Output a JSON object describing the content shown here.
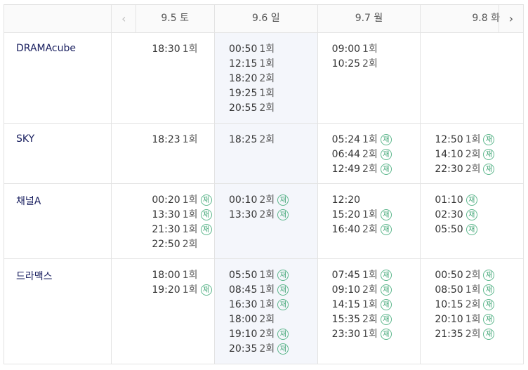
{
  "nav": {
    "prev_icon": "‹",
    "next_icon": "›"
  },
  "days": [
    "9.5 토",
    "9.6 일",
    "9.7 월",
    "9.8 화"
  ],
  "rerun_badge": "재",
  "channels": [
    {
      "name": "DRAMAcube",
      "slots": [
        [
          {
            "time": "18:30",
            "ep": "1회",
            "re": false
          }
        ],
        [
          {
            "time": "00:50",
            "ep": "1회",
            "re": false
          },
          {
            "time": "12:15",
            "ep": "1회",
            "re": false
          },
          {
            "time": "18:20",
            "ep": "2회",
            "re": false
          },
          {
            "time": "19:25",
            "ep": "1회",
            "re": false
          },
          {
            "time": "20:55",
            "ep": "2회",
            "re": false
          }
        ],
        [
          {
            "time": "09:00",
            "ep": "1회",
            "re": false
          },
          {
            "time": "10:25",
            "ep": "2회",
            "re": false
          }
        ],
        []
      ]
    },
    {
      "name": "SKY",
      "slots": [
        [
          {
            "time": "18:23",
            "ep": "1회",
            "re": false
          }
        ],
        [
          {
            "time": "18:25",
            "ep": "2회",
            "re": false
          }
        ],
        [
          {
            "time": "05:24",
            "ep": "1회",
            "re": true
          },
          {
            "time": "06:44",
            "ep": "2회",
            "re": true
          },
          {
            "time": "12:49",
            "ep": "2회",
            "re": true
          }
        ],
        [
          {
            "time": "12:50",
            "ep": "1회",
            "re": true
          },
          {
            "time": "14:10",
            "ep": "2회",
            "re": true
          },
          {
            "time": "22:30",
            "ep": "2회",
            "re": true
          }
        ]
      ]
    },
    {
      "name": "채널A",
      "slots": [
        [
          {
            "time": "00:20",
            "ep": "1회",
            "re": true
          },
          {
            "time": "13:30",
            "ep": "1회",
            "re": true
          },
          {
            "time": "21:30",
            "ep": "1회",
            "re": true
          },
          {
            "time": "22:50",
            "ep": "2회",
            "re": false
          }
        ],
        [
          {
            "time": "00:10",
            "ep": "2회",
            "re": true
          },
          {
            "time": "13:30",
            "ep": "2회",
            "re": true
          }
        ],
        [
          {
            "time": "12:20",
            "ep": "",
            "re": false
          },
          {
            "time": "15:20",
            "ep": "1회",
            "re": true
          },
          {
            "time": "16:40",
            "ep": "2회",
            "re": true
          }
        ],
        [
          {
            "time": "01:10",
            "ep": "",
            "re": true
          },
          {
            "time": "02:30",
            "ep": "",
            "re": true
          },
          {
            "time": "05:50",
            "ep": "",
            "re": true
          }
        ]
      ]
    },
    {
      "name": "드라맥스",
      "slots": [
        [
          {
            "time": "18:00",
            "ep": "1회",
            "re": false
          },
          {
            "time": "19:20",
            "ep": "1회",
            "re": true
          }
        ],
        [
          {
            "time": "05:50",
            "ep": "1회",
            "re": true
          },
          {
            "time": "08:45",
            "ep": "1회",
            "re": true
          },
          {
            "time": "16:30",
            "ep": "1회",
            "re": true
          },
          {
            "time": "18:00",
            "ep": "2회",
            "re": false
          },
          {
            "time": "19:10",
            "ep": "2회",
            "re": true
          },
          {
            "time": "20:35",
            "ep": "2회",
            "re": true
          }
        ],
        [
          {
            "time": "07:45",
            "ep": "1회",
            "re": true
          },
          {
            "time": "09:10",
            "ep": "2회",
            "re": true
          },
          {
            "time": "14:15",
            "ep": "1회",
            "re": true
          },
          {
            "time": "15:35",
            "ep": "2회",
            "re": true
          },
          {
            "time": "23:30",
            "ep": "1회",
            "re": true
          }
        ],
        [
          {
            "time": "00:50",
            "ep": "2회",
            "re": true
          },
          {
            "time": "08:50",
            "ep": "1회",
            "re": true
          },
          {
            "time": "10:15",
            "ep": "2회",
            "re": true
          },
          {
            "time": "20:10",
            "ep": "1회",
            "re": true
          },
          {
            "time": "21:35",
            "ep": "2회",
            "re": true
          }
        ]
      ]
    }
  ]
}
